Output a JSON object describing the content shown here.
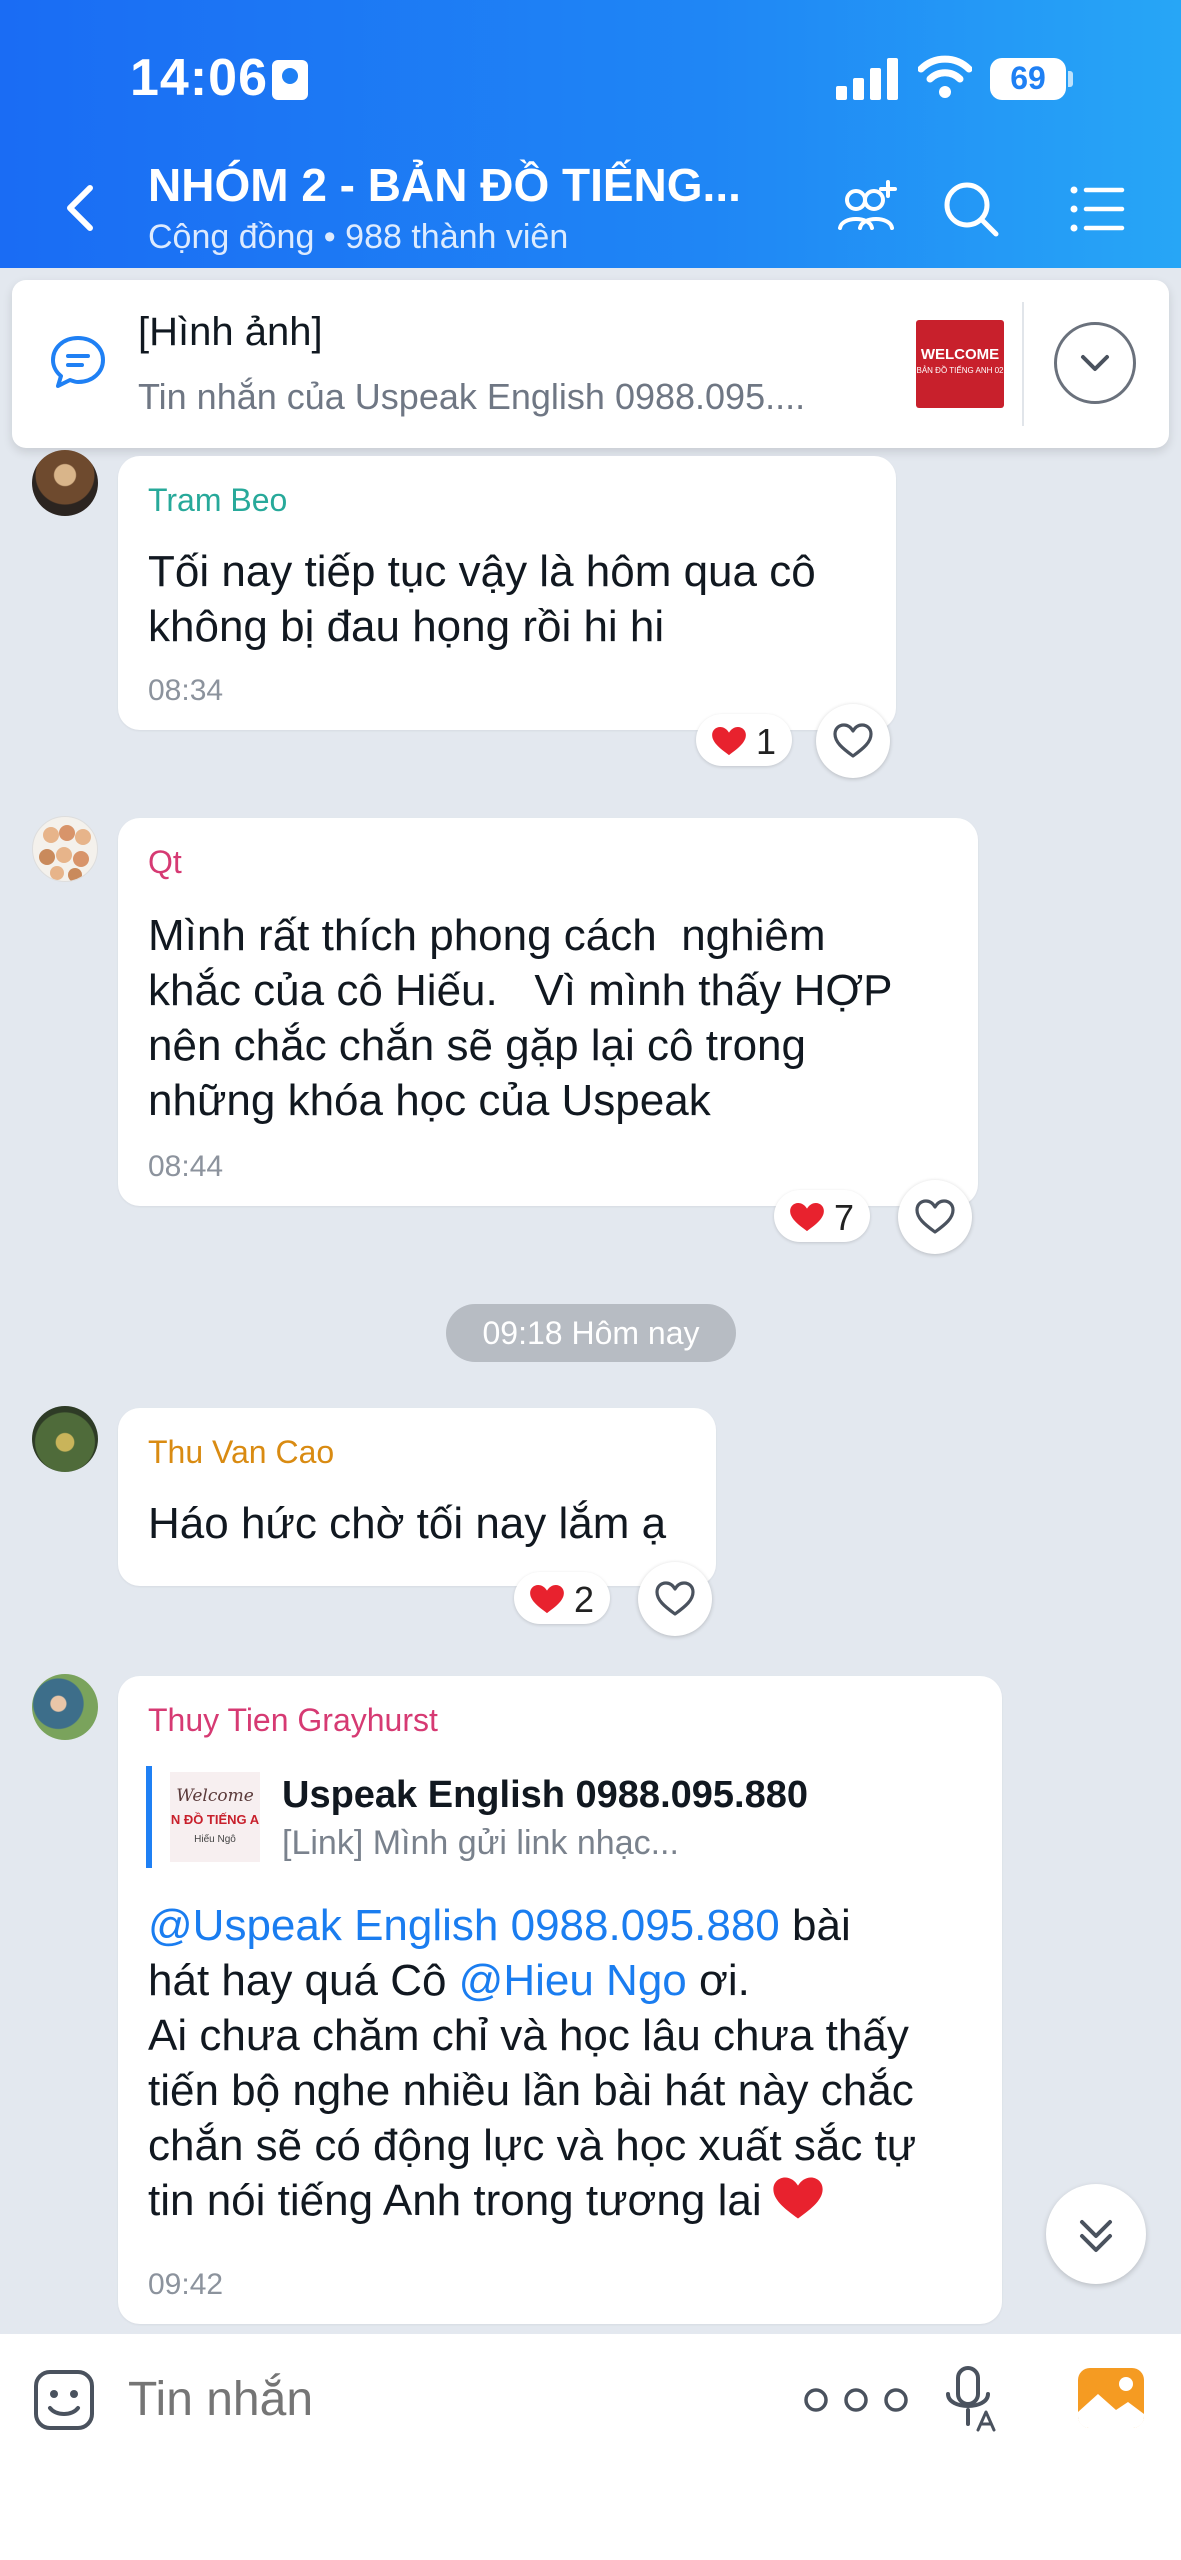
{
  "status_bar": {
    "time": "14:06",
    "battery": "69"
  },
  "header": {
    "title": "NHÓM 2 - BẢN ĐỒ TIẾNG...",
    "subtitle": "Cộng đồng • 988 thành viên"
  },
  "pinned": {
    "title": "[Hình ảnh]",
    "preview": "Tin nhắn của Uspeak English 0988.095....",
    "thumb_main": "WELCOME",
    "thumb_sub": "BẢN ĐỒ TIẾNG ANH 02"
  },
  "messages": [
    {
      "sender": "Tram Beo",
      "sender_color": "#27a99a",
      "lines": [
        "Tối nay tiếp tục vậy là hôm qua cô",
        "không bị đau họng rồi hi hi"
      ],
      "time": "08:34",
      "reaction_count": "1"
    },
    {
      "sender": "Qt",
      "sender_color": "#d63a73",
      "lines": [
        "Mình rất thích phong cách  nghiêm",
        "khắc của cô Hiếu.   Vì mình thấy HỢP",
        "nên chắc chắn sẽ gặp lại cô trong",
        "những khóa học của Uspeak"
      ],
      "time": "08:44",
      "reaction_count": "7"
    },
    {
      "sender": "Thu Van Cao",
      "sender_color": "#d98b12",
      "lines": [
        "Háo hức chờ tối nay lắm ạ"
      ],
      "reaction_count": "2"
    },
    {
      "sender": "Thuy Tien Grayhurst",
      "sender_color": "#d63a73",
      "quote": {
        "name": "Uspeak English 0988.095.880",
        "text": "[Link] Mình gửi link nhạc...",
        "thumb_line1": "Welcome",
        "thumb_line2": "N ĐỒ TIẾNG A",
        "thumb_line3": "Hiếu Ngô"
      },
      "mention1": "@Uspeak English 0988.095.880",
      "after_mention1": " bài",
      "line2_pre": "hát hay quá Cô ",
      "mention2": "@Hieu Ngo",
      "line2_post": " ơi.",
      "lines": [
        "Ai chưa chăm chỉ và học lâu chưa thấy",
        "tiến bộ nghe nhiều lần bài hát này chắc",
        "chắn sẽ có động lực và học xuất sắc tự",
        "tin nói tiếng Anh trong tương lai"
      ],
      "time": "09:42"
    }
  ],
  "date_separator": "09:18 Hôm nay",
  "input": {
    "placeholder": "Tin nhắn"
  },
  "colors": {
    "header_start": "#1a6cf4",
    "header_end": "#27a6f6",
    "accent": "#1f80f4",
    "heart": "#e8222e"
  },
  "icons": [
    "back-arrow-icon",
    "add-member-icon",
    "search-icon",
    "menu-list-icon",
    "pinned-message-icon",
    "chevron-down-icon",
    "heart-icon",
    "like-outline-icon",
    "emoji-icon",
    "more-dots-icon",
    "microphone-icon",
    "image-icon",
    "double-chevron-down-icon"
  ]
}
